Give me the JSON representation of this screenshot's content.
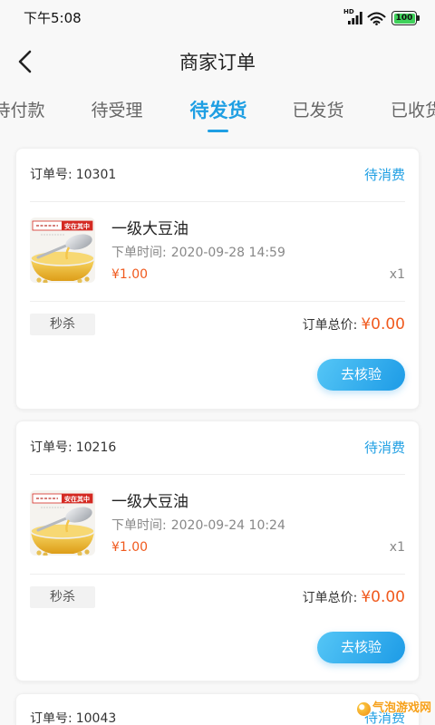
{
  "status_bar": {
    "time": "下午5:08",
    "network_label": "HD",
    "battery_level": "100",
    "icons": [
      "signal-icon",
      "wifi-icon",
      "battery-icon"
    ]
  },
  "header": {
    "title": "商家订单",
    "back_icon": "chevron-left-icon"
  },
  "tabs": {
    "active_index": 2,
    "items": [
      {
        "label": "待付款"
      },
      {
        "label": "待受理"
      },
      {
        "label": "待发货"
      },
      {
        "label": "已发货"
      },
      {
        "label": "已收货"
      }
    ]
  },
  "labels": {
    "order_no": "订单号:",
    "order_time": "下单时间:",
    "order_total": "订单总价:",
    "verify_button": "去核验"
  },
  "colors": {
    "accent": "#1f9fe3",
    "price": "#f05a1e",
    "button_gradient_start": "#55c6f6",
    "button_gradient_end": "#1d9be6",
    "battery": "#3fd15a",
    "watermark": "#f6a019"
  },
  "orders": [
    {
      "order_no": "10301",
      "status": "待消费",
      "product": {
        "name": "一级大豆油",
        "image_label": "安在其中"
      },
      "order_time": "2020-09-28 14:59",
      "price": "¥1.00",
      "quantity": "x1",
      "tag": "秒杀",
      "total": "¥0.00"
    },
    {
      "order_no": "10216",
      "status": "待消费",
      "product": {
        "name": "一级大豆油",
        "image_label": "安在其中"
      },
      "order_time": "2020-09-24 10:24",
      "price": "¥1.00",
      "quantity": "x1",
      "tag": "秒杀",
      "total": "¥0.00"
    },
    {
      "order_no": "10043",
      "status": "待消费"
    }
  ],
  "watermark": {
    "text": "气泡游戏网"
  }
}
